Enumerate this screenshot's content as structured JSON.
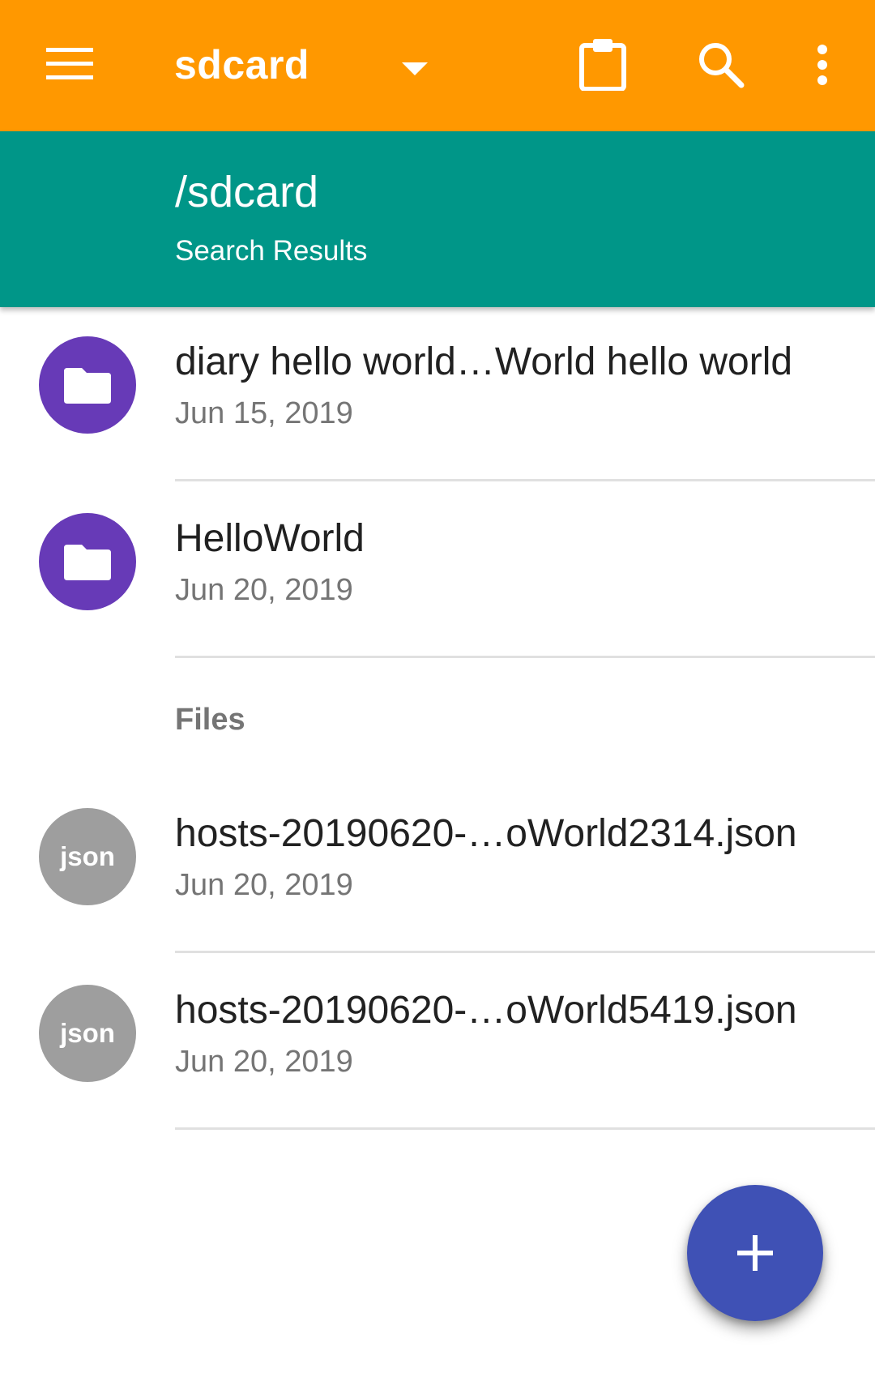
{
  "toolbar": {
    "title": "sdcard",
    "icons": {
      "menu": "menu-icon",
      "dropdown": "dropdown-icon",
      "clipboard": "clipboard-icon",
      "search": "search-icon",
      "more": "more-vert-icon"
    },
    "background_color": "#FF9800"
  },
  "path_header": {
    "path": "/sdcard",
    "subtitle": "Search Results",
    "background_color": "#009688"
  },
  "folders": [
    {
      "name": "diary hello world…World hello world",
      "date": "Jun 15, 2019",
      "icon": "folder-icon"
    },
    {
      "name": "HelloWorld",
      "date": "Jun 20, 2019",
      "icon": "folder-icon"
    }
  ],
  "files_section": {
    "label": "Files",
    "items": [
      {
        "name": "hosts-20190620-…oWorld2314.json",
        "date": "Jun 20, 2019",
        "type_badge": "json"
      },
      {
        "name": "hosts-20190620-…oWorld5419.json",
        "date": "Jun 20, 2019",
        "type_badge": "json"
      }
    ]
  },
  "fab": {
    "icon": "add-icon",
    "color": "#3F51B5"
  },
  "colors": {
    "folder_avatar": "#673AB7",
    "file_avatar": "#9E9E9E"
  }
}
